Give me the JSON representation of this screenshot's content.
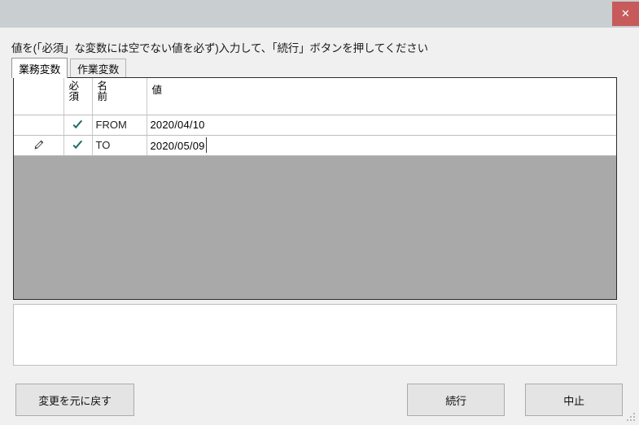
{
  "window": {
    "close_label": "✕"
  },
  "instruction": "値を(「必須」な変数には空でない値を必ず)入力して、「続行」ボタンを押してください",
  "tabs": [
    {
      "label": "業務変数",
      "active": true
    },
    {
      "label": "作業変数",
      "active": false
    }
  ],
  "grid": {
    "columns": [
      {
        "key": "indicator",
        "label": ""
      },
      {
        "key": "required",
        "label": "必須"
      },
      {
        "key": "name",
        "label": "名前"
      },
      {
        "key": "value",
        "label": "値"
      }
    ],
    "rows": [
      {
        "indicator": "",
        "required": "checkmark-icon",
        "name": "FROM",
        "value": "2020/04/10",
        "editing": false
      },
      {
        "indicator": "pencil-icon",
        "required": "checkmark-icon",
        "name": "TO",
        "value": "2020/05/09",
        "editing": true
      }
    ]
  },
  "description_panel": {
    "text": ""
  },
  "buttons": {
    "undo": "変更を元に戻す",
    "continue": "続行",
    "cancel": "中止"
  },
  "colors": {
    "titlebar": "#c9ced1",
    "close_button": "#c75b5b",
    "grid_empty_area": "#a9a9a9",
    "checkmark": "#1d6e61",
    "body": "#f0f0f0",
    "button_face": "#e4e4e4"
  }
}
